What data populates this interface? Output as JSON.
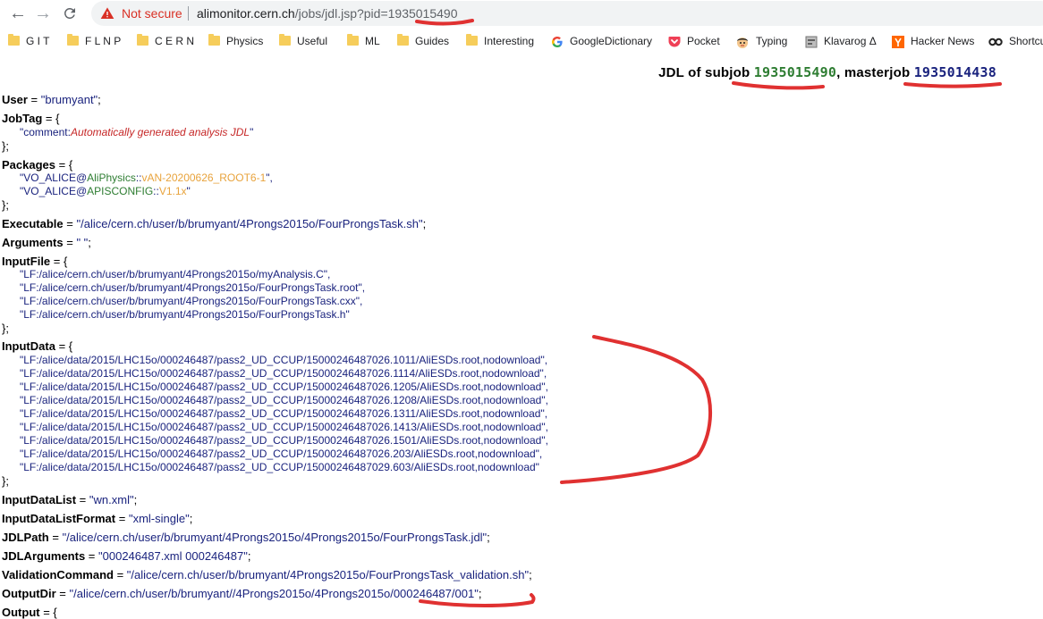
{
  "browser": {
    "back_icon": "arrow-left-icon",
    "forward_icon": "arrow-right-icon",
    "reload_icon": "reload-icon",
    "security_icon": "warning-triangle-icon",
    "security_label": "Not secure",
    "url_host": "alimonitor.cern.ch",
    "url_path": "/jobs/jdl.jsp?pid=1935015490"
  },
  "bookmarks": [
    {
      "label": "G I T",
      "icon": "folder-icon"
    },
    {
      "label": "F L N P",
      "icon": "folder-icon"
    },
    {
      "label": "C E R N",
      "icon": "folder-icon"
    },
    {
      "label": "Physics",
      "icon": "folder-icon"
    },
    {
      "label": "Useful",
      "icon": "folder-icon"
    },
    {
      "label": "ML",
      "icon": "folder-icon"
    },
    {
      "label": "Guides",
      "icon": "folder-icon"
    },
    {
      "label": "Interesting",
      "icon": "folder-icon"
    },
    {
      "label": "GoogleDictionary",
      "icon": "google-icon"
    },
    {
      "label": "Pocket",
      "icon": "pocket-icon"
    },
    {
      "label": "Typing",
      "icon": "typing-icon"
    },
    {
      "label": "Klavarog Δ",
      "icon": "page-icon"
    },
    {
      "label": "Hacker News",
      "icon": "hacker-news-icon"
    },
    {
      "label": "Shortcu",
      "icon": "shortcut-icon"
    }
  ],
  "header": {
    "prefix": "JDL of subjob",
    "subjob": "1935015490",
    "mid": ", masterjob",
    "masterjob": "1935014438"
  },
  "jdl": {
    "user": {
      "key": "User",
      "value": "\"brumyant\""
    },
    "jobtag": {
      "key": "JobTag",
      "comment_key": "\"comment:",
      "comment_value": "Automatically generated analysis JDL",
      "comment_end": "\""
    },
    "packages": {
      "key": "Packages",
      "items": [
        {
          "prefix": "\"VO_ALICE@",
          "name": "AliPhysics",
          "sep": "::",
          "version": "vAN-20200626_ROOT6-1",
          "end": "\","
        },
        {
          "prefix": "\"VO_ALICE@",
          "name": "APISCONFIG",
          "sep": "::",
          "version": "V1.1x",
          "end": "\""
        }
      ]
    },
    "executable": {
      "key": "Executable",
      "value": "\"/alice/cern.ch/user/b/brumyant/4Prongs2015o/FourProngsTask.sh\""
    },
    "arguments": {
      "key": "Arguments",
      "value": "\" \""
    },
    "inputfile": {
      "key": "InputFile",
      "items": [
        "\"LF:/alice/cern.ch/user/b/brumyant/4Prongs2015o/myAnalysis.C\",",
        "\"LF:/alice/cern.ch/user/b/brumyant/4Prongs2015o/FourProngsTask.root\",",
        "\"LF:/alice/cern.ch/user/b/brumyant/4Prongs2015o/FourProngsTask.cxx\",",
        "\"LF:/alice/cern.ch/user/b/brumyant/4Prongs2015o/FourProngsTask.h\""
      ]
    },
    "inputdata": {
      "key": "InputData",
      "items": [
        "\"LF:/alice/data/2015/LHC15o/000246487/pass2_UD_CCUP/15000246487026.1011/AliESDs.root,nodownload\",",
        "\"LF:/alice/data/2015/LHC15o/000246487/pass2_UD_CCUP/15000246487026.1114/AliESDs.root,nodownload\",",
        "\"LF:/alice/data/2015/LHC15o/000246487/pass2_UD_CCUP/15000246487026.1205/AliESDs.root,nodownload\",",
        "\"LF:/alice/data/2015/LHC15o/000246487/pass2_UD_CCUP/15000246487026.1208/AliESDs.root,nodownload\",",
        "\"LF:/alice/data/2015/LHC15o/000246487/pass2_UD_CCUP/15000246487026.1311/AliESDs.root,nodownload\",",
        "\"LF:/alice/data/2015/LHC15o/000246487/pass2_UD_CCUP/15000246487026.1413/AliESDs.root,nodownload\",",
        "\"LF:/alice/data/2015/LHC15o/000246487/pass2_UD_CCUP/15000246487026.1501/AliESDs.root,nodownload\",",
        "\"LF:/alice/data/2015/LHC15o/000246487/pass2_UD_CCUP/15000246487026.203/AliESDs.root,nodownload\",",
        "\"LF:/alice/data/2015/LHC15o/000246487/pass2_UD_CCUP/15000246487029.603/AliESDs.root,nodownload\""
      ]
    },
    "inputdatalist": {
      "key": "InputDataList",
      "value": "\"wn.xml\""
    },
    "inputdatalistformat": {
      "key": "InputDataListFormat",
      "value": "\"xml-single\""
    },
    "jdlpath": {
      "key": "JDLPath",
      "value": "\"/alice/cern.ch/user/b/brumyant/4Prongs2015o/4Prongs2015o/FourProngsTask.jdl\""
    },
    "jdlarguments": {
      "key": "JDLArguments",
      "value": "\"000246487.xml 000246487\""
    },
    "validationcommand": {
      "key": "ValidationCommand",
      "value": "\"/alice/cern.ch/user/b/brumyant/4Prongs2015o/FourProngsTask_validation.sh\""
    },
    "outputdir": {
      "key": "OutputDir",
      "value": "\"/alice/cern.ch/user/b/brumyant//4Prongs2015o/4Prongs2015o/000246487/001\""
    },
    "output": {
      "key": "Output"
    }
  },
  "annotation_color": "#e03131"
}
